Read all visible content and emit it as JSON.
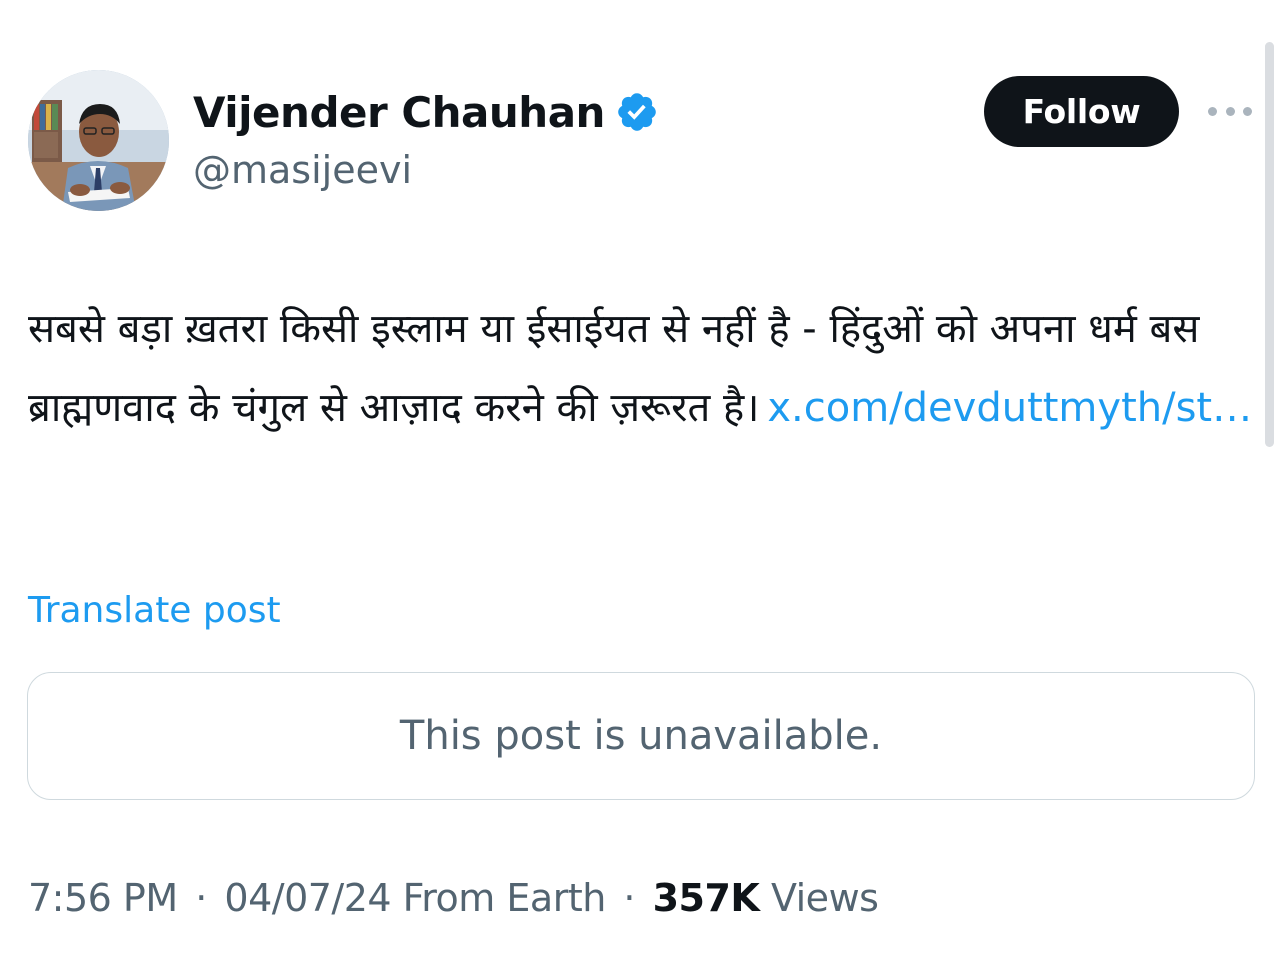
{
  "author": {
    "display_name": "Vijender Chauhan",
    "handle": "@masijeevi",
    "verified_icon": "verified-badge-icon",
    "verified_color": "#1d9bf0"
  },
  "actions": {
    "follow_label": "Follow",
    "more_icon": "more-dots-icon"
  },
  "post": {
    "text": "सबसे बड़ा ख़तरा किसी इस्लाम या ईसाईयत से नहीं है - हिंदुओं को अपना धर्म बस ब्राह्मणवाद के चंगुल से आज़ाद करने की ज़रूरत है।",
    "link": "x.com/devduttmyth/st…",
    "translate_label": "Translate post"
  },
  "quoted_post": {
    "status_text": "This post is unavailable."
  },
  "meta": {
    "time": "7:56 PM",
    "date": "04/07/24",
    "source": "From Earth",
    "separator": "·",
    "views_count": "357K",
    "views_label": "Views"
  },
  "colors": {
    "text_primary": "#0f1419",
    "text_secondary": "#536471",
    "link": "#1d9bf0",
    "border": "#cfd9de",
    "follow_bg": "#0f1419"
  }
}
